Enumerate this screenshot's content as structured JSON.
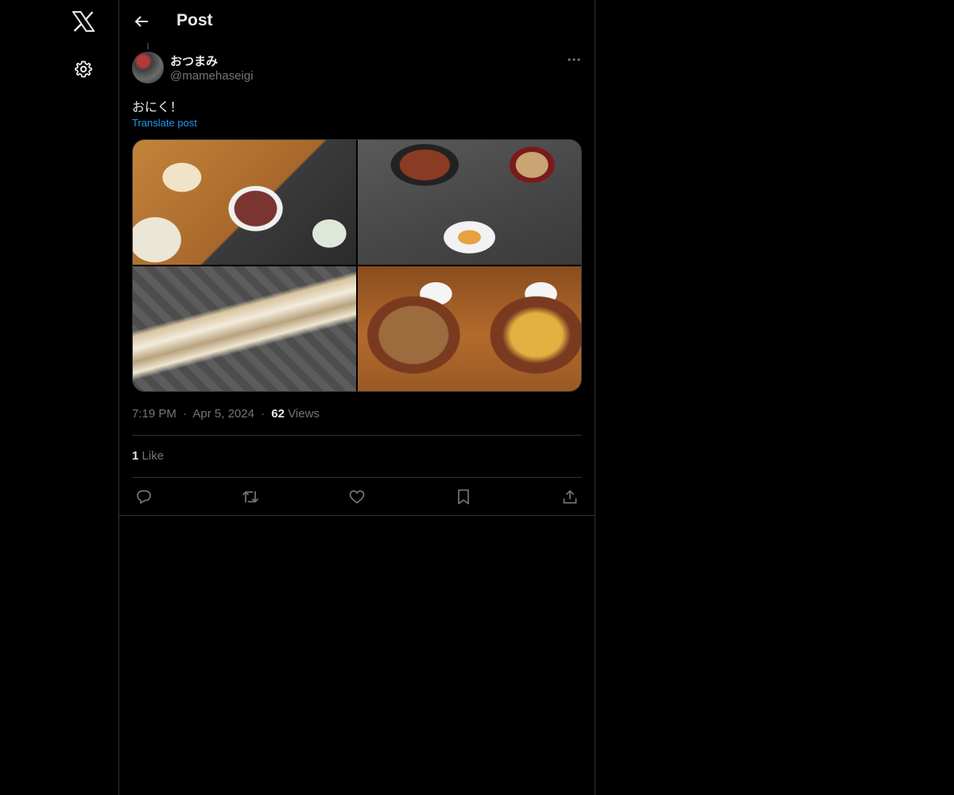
{
  "nav": {
    "logo_icon": "x-logo-icon",
    "settings_icon": "gear-icon"
  },
  "header": {
    "title": "Post",
    "back_icon": "arrow-left-icon"
  },
  "post": {
    "author_name": "おつまみ",
    "author_handle": "@mamehaseigi",
    "text": "おにく！",
    "translate_label": "Translate post",
    "time": "7:19 PM",
    "date": "Apr 5, 2024",
    "views_count": "62",
    "views_label": "Views",
    "likes_count": "1",
    "likes_label": "Like",
    "separator": "·"
  },
  "actions": [
    {
      "icon": "reply-icon"
    },
    {
      "icon": "repost-icon"
    },
    {
      "icon": "like-icon"
    },
    {
      "icon": "bookmark-icon"
    },
    {
      "icon": "share-icon"
    }
  ],
  "colors": {
    "background": "#000000",
    "text": "#e7e9ea",
    "secondary_text": "#71767b",
    "link": "#1d9bf0",
    "border": "#2f3336"
  }
}
